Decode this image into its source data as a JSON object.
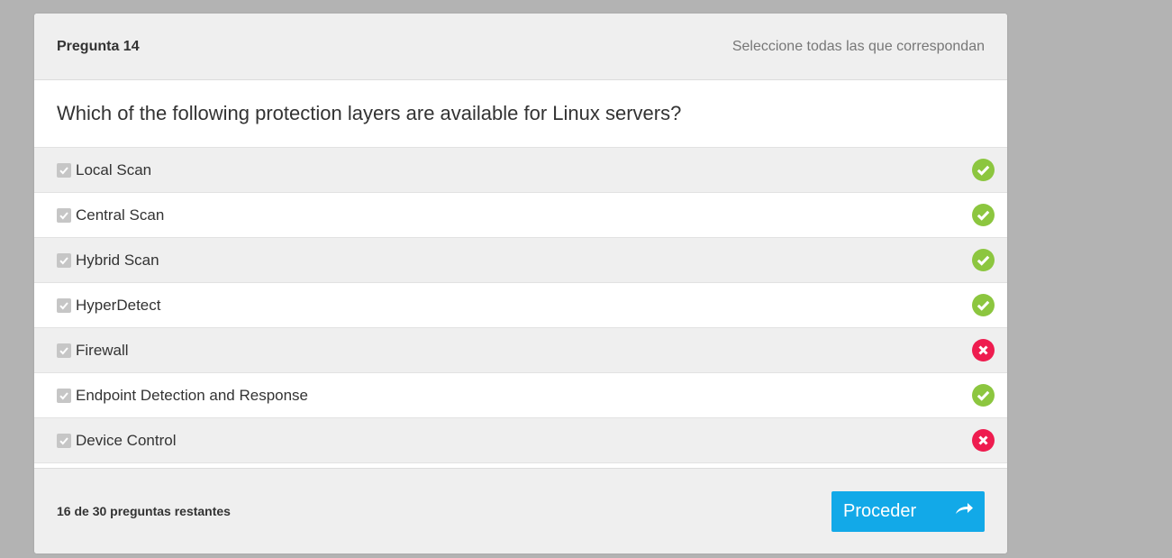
{
  "header": {
    "question_number": "Pregunta 14",
    "instruction": "Seleccione todas las que correspondan"
  },
  "question": {
    "text": "Which of the following protection layers are available for Linux servers?"
  },
  "options": [
    {
      "label": "Local Scan",
      "checked": true,
      "result": "correct"
    },
    {
      "label": "Central Scan",
      "checked": true,
      "result": "correct"
    },
    {
      "label": "Hybrid Scan",
      "checked": true,
      "result": "correct"
    },
    {
      "label": "HyperDetect",
      "checked": true,
      "result": "correct"
    },
    {
      "label": "Firewall",
      "checked": true,
      "result": "incorrect"
    },
    {
      "label": "Endpoint Detection and Response",
      "checked": true,
      "result": "correct"
    },
    {
      "label": "Device Control",
      "checked": true,
      "result": "incorrect"
    }
  ],
  "footer": {
    "remaining": "16 de 30 preguntas restantes",
    "proceed_label": "Proceder",
    "proceed_icon": "arrow-share-icon"
  },
  "colors": {
    "correct": "#8cc63f",
    "incorrect": "#ee1c4f",
    "accent": "#12a9e8"
  }
}
